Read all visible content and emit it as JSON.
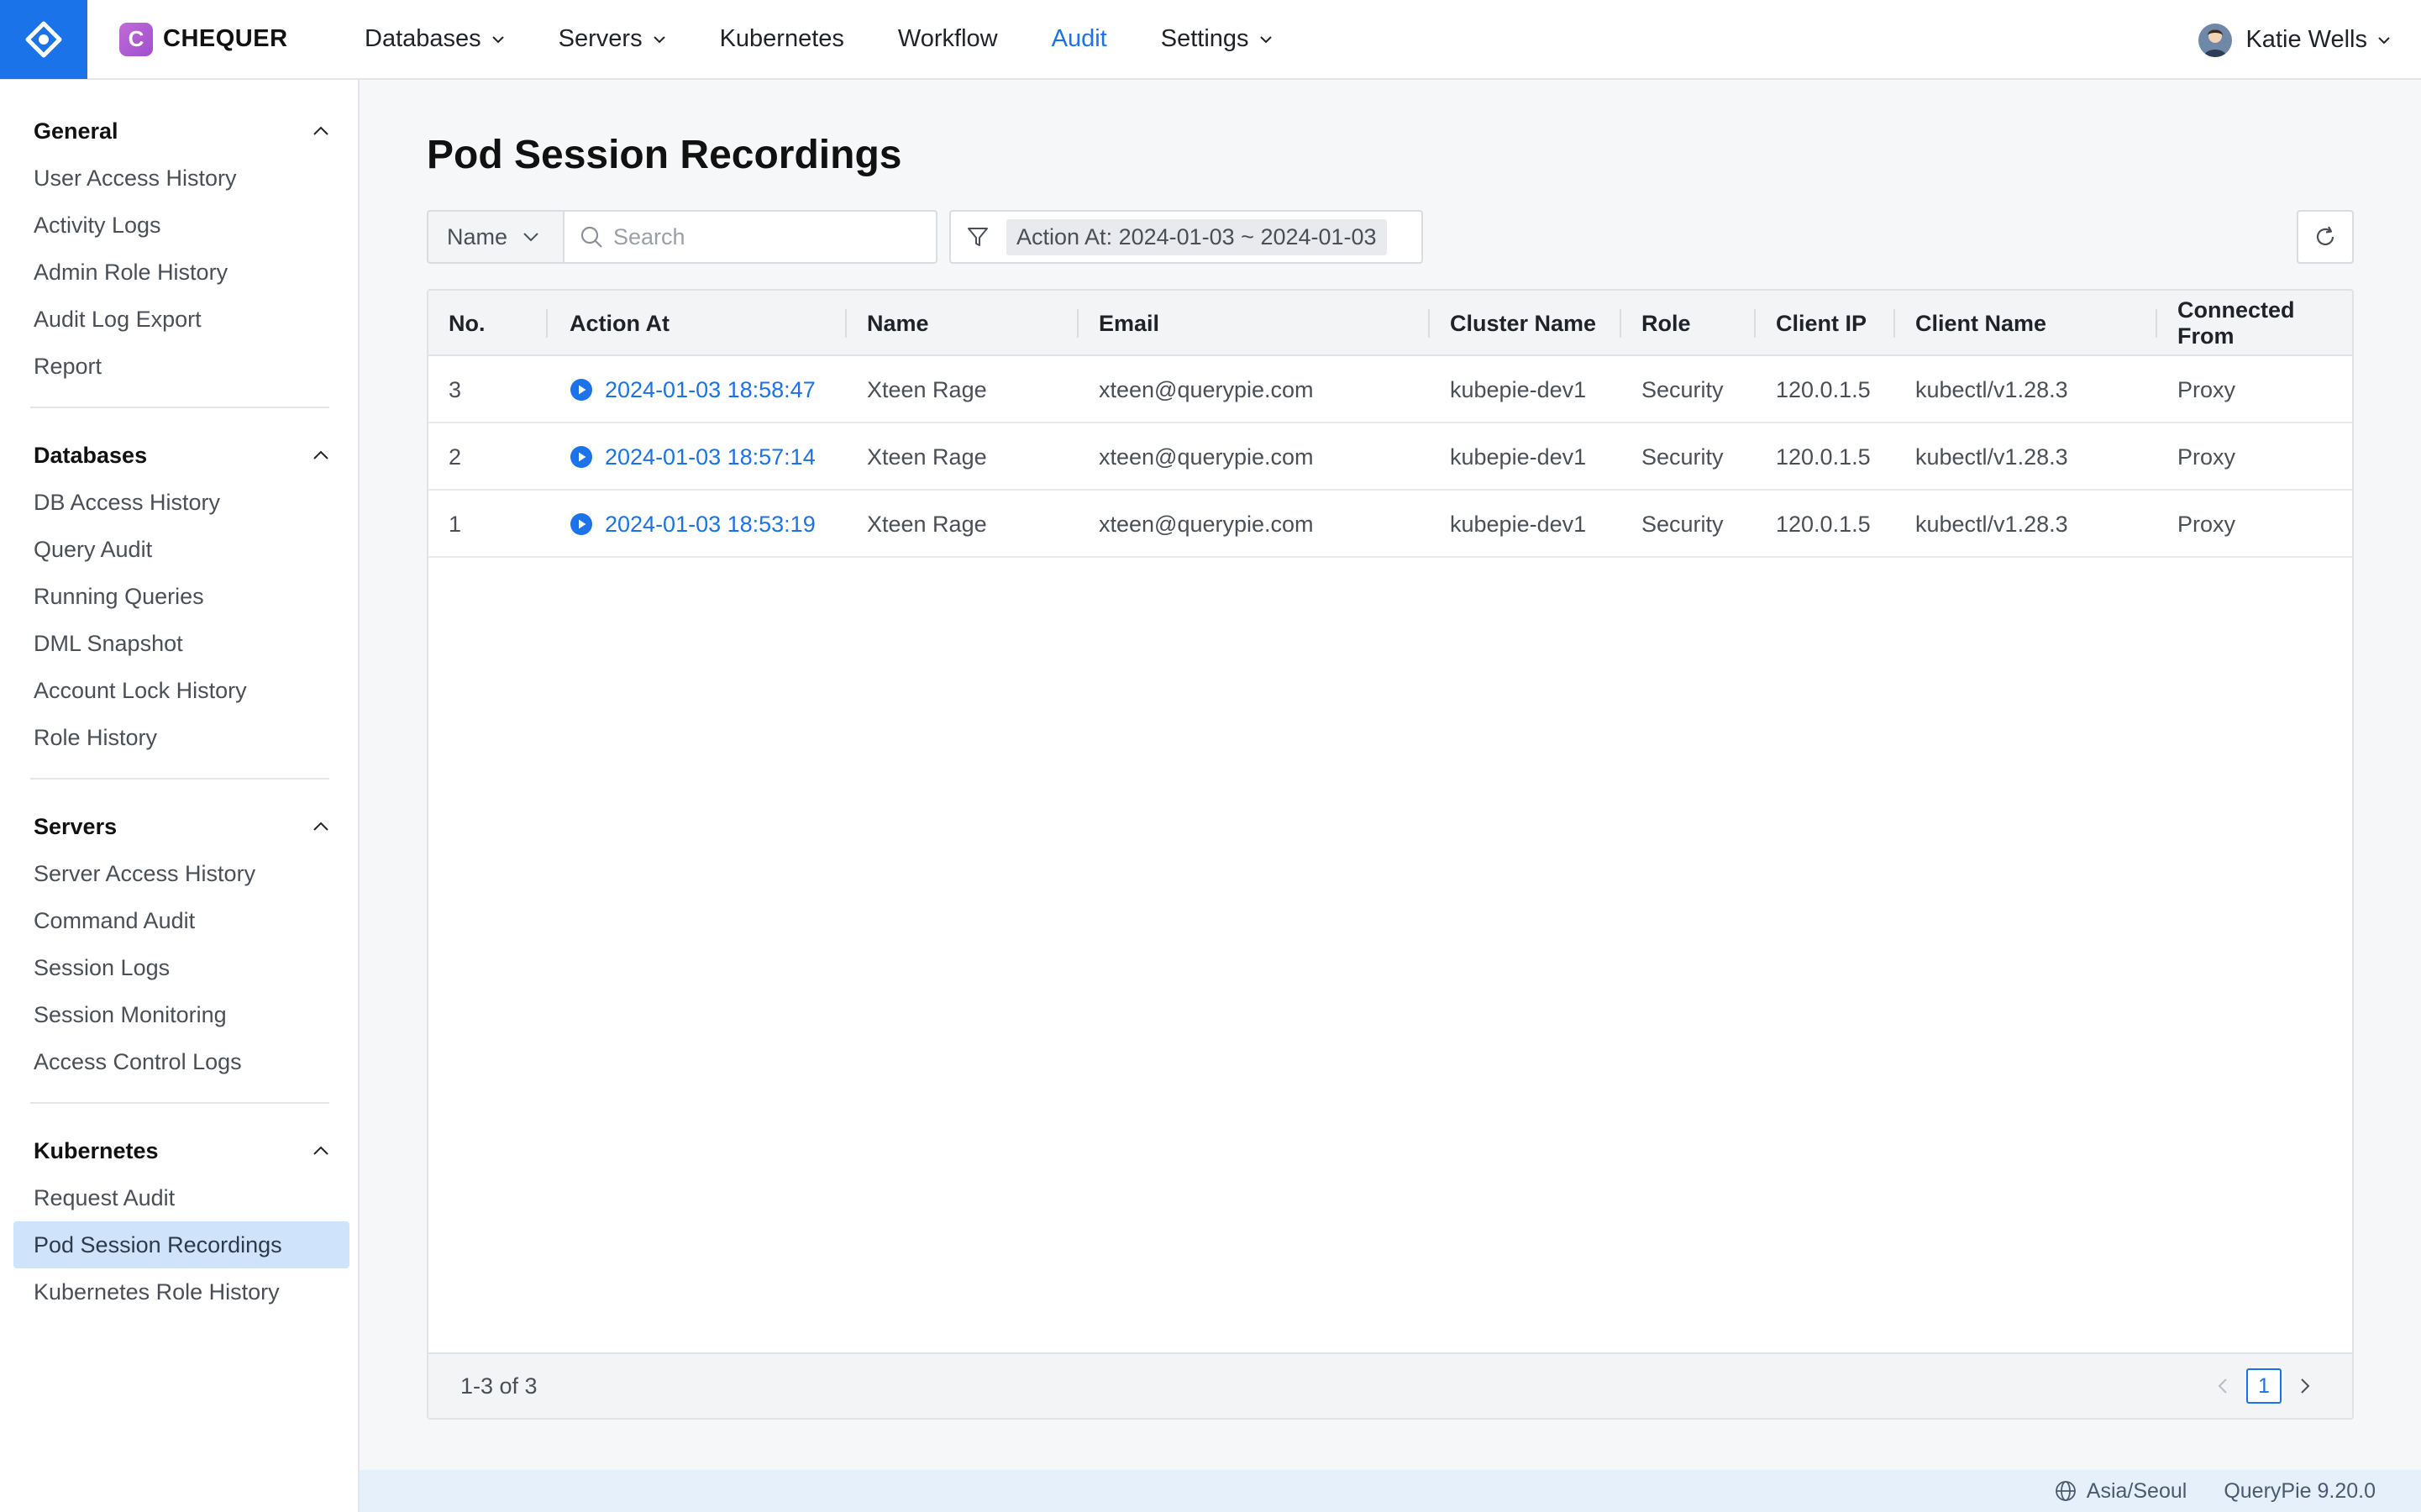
{
  "brand": {
    "name": "CHEQUER",
    "badge": "C"
  },
  "nav": {
    "items": [
      {
        "label": "Databases",
        "dropdown": true,
        "active": false
      },
      {
        "label": "Servers",
        "dropdown": true,
        "active": false
      },
      {
        "label": "Kubernetes",
        "dropdown": false,
        "active": false
      },
      {
        "label": "Workflow",
        "dropdown": false,
        "active": false
      },
      {
        "label": "Audit",
        "dropdown": false,
        "active": true
      },
      {
        "label": "Settings",
        "dropdown": true,
        "active": false
      }
    ],
    "user": "Katie Wells"
  },
  "sidebar": {
    "sections": [
      {
        "title": "General",
        "items": [
          "User Access History",
          "Activity Logs",
          "Admin Role History",
          "Audit Log Export",
          "Report"
        ]
      },
      {
        "title": "Databases",
        "items": [
          "DB Access History",
          "Query Audit",
          "Running Queries",
          "DML Snapshot",
          "Account Lock History",
          "Role History"
        ]
      },
      {
        "title": "Servers",
        "items": [
          "Server Access History",
          "Command Audit",
          "Session Logs",
          "Session Monitoring",
          "Access Control Logs"
        ]
      },
      {
        "title": "Kubernetes",
        "items": [
          "Request Audit",
          "Pod Session Recordings",
          "Kubernetes Role History"
        ]
      }
    ],
    "active_item": "Pod Session Recordings"
  },
  "page": {
    "title": "Pod Session Recordings",
    "search_field": "Name",
    "search_placeholder": "Search",
    "filter_label": "Action At: 2024-01-03 ~ 2024-01-03"
  },
  "table": {
    "columns": [
      "No.",
      "Action At",
      "Name",
      "Email",
      "Cluster Name",
      "Role",
      "Client IP",
      "Client Name",
      "Connected From"
    ],
    "rows": [
      [
        "3",
        "2024-01-03 18:58:47",
        "Xteen Rage",
        "xteen@querypie.com",
        "kubepie-dev1",
        "Security",
        "120.0.1.5",
        "kubectl/v1.28.3",
        "Proxy"
      ],
      [
        "2",
        "2024-01-03 18:57:14",
        "Xteen Rage",
        "xteen@querypie.com",
        "kubepie-dev1",
        "Security",
        "120.0.1.5",
        "kubectl/v1.28.3",
        "Proxy"
      ],
      [
        "1",
        "2024-01-03 18:53:19",
        "Xteen Rage",
        "xteen@querypie.com",
        "kubepie-dev1",
        "Security",
        "120.0.1.5",
        "kubectl/v1.28.3",
        "Proxy"
      ]
    ],
    "range_text": "1-3 of 3",
    "current_page": "1"
  },
  "status": {
    "timezone": "Asia/Seoul",
    "version": "QueryPie 9.20.0"
  },
  "colors": {
    "accent": "#1a73e8",
    "active_bg": "#cfe4fb",
    "brand_badge": "#b05cd3"
  }
}
